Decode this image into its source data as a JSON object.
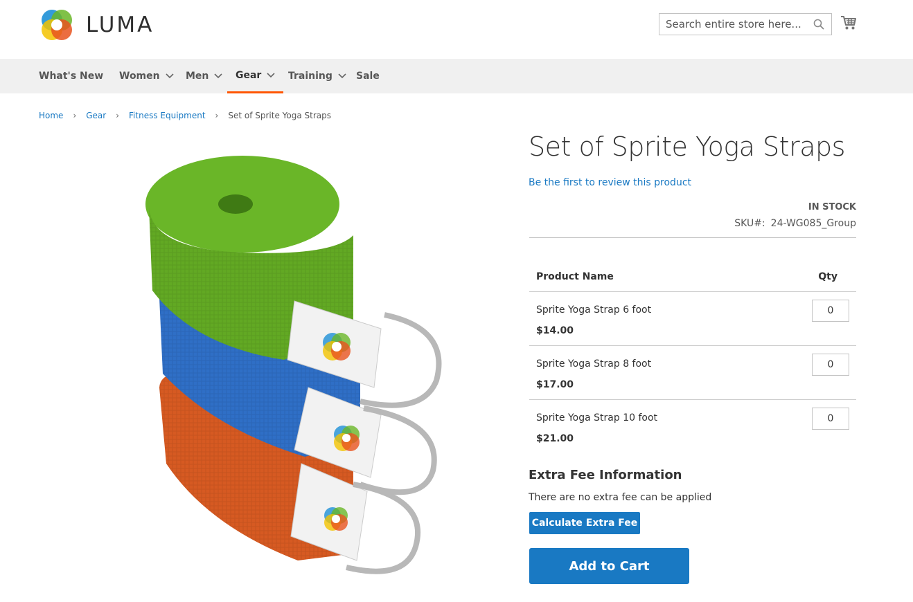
{
  "header": {
    "logo_text": "LUMA",
    "search_placeholder": "Search entire store here..."
  },
  "nav": {
    "items": [
      {
        "label": "What's New",
        "has_dropdown": false
      },
      {
        "label": "Women",
        "has_dropdown": true
      },
      {
        "label": "Men",
        "has_dropdown": true
      },
      {
        "label": "Gear",
        "has_dropdown": true,
        "active": true
      },
      {
        "label": "Training",
        "has_dropdown": true
      },
      {
        "label": "Sale",
        "has_dropdown": false
      }
    ]
  },
  "breadcrumb": {
    "items": [
      "Home",
      "Gear",
      "Fitness Equipment"
    ],
    "current": "Set of Sprite Yoga Straps"
  },
  "product": {
    "title": "Set of Sprite Yoga Straps",
    "review_link": "Be the first to review this product",
    "stock": "IN STOCK",
    "sku_label": "SKU#:",
    "sku_value": "24-WG085_Group",
    "table": {
      "col_name": "Product Name",
      "col_qty": "Qty",
      "rows": [
        {
          "name": "Sprite Yoga Strap 6 foot",
          "price": "$14.00",
          "qty": "0"
        },
        {
          "name": "Sprite Yoga Strap 8 foot",
          "price": "$17.00",
          "qty": "0"
        },
        {
          "name": "Sprite Yoga Strap 10 foot",
          "price": "$21.00",
          "qty": "0"
        }
      ]
    },
    "extra_fee": {
      "title": "Extra Fee Information",
      "note": "There are no extra fee can be applied",
      "button": "Calculate Extra Fee"
    },
    "add_to_cart": "Add to Cart"
  },
  "colors": {
    "accent": "#1979c3",
    "nav_active": "#ff5501",
    "strap_green": "#6ab628",
    "strap_blue": "#2f6fc6",
    "strap_orange": "#d65a22"
  }
}
